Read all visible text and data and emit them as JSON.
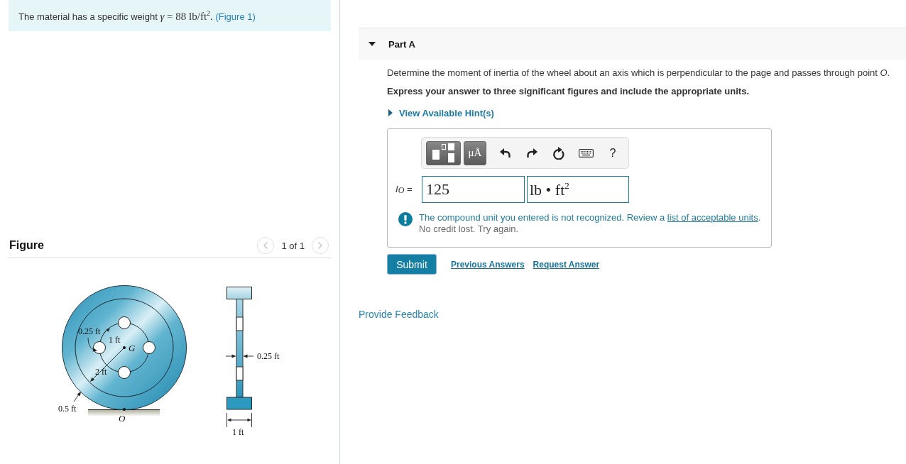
{
  "problem": {
    "text": "The material has a specific weight",
    "formula": "*γ* = 88 lb/ft$^{2}$.",
    "figure_link": "(Figure 1)"
  },
  "figure_panel": {
    "title": "Figure",
    "pager": {
      "previous": {
        "disabled": true
      },
      "counter": "1 of 1",
      "next": {
        "disabled": true
      }
    },
    "front_view": {
      "hole_radius": "0.25 ft",
      "hole_circle_radius": "1 ft",
      "center_point": "G",
      "inner_radius": "2 ft",
      "rim_thickness": "0.5 ft",
      "contact_point": "O"
    },
    "side_view": {
      "web_thickness": "0.25 ft",
      "width": "1 ft"
    }
  },
  "part": {
    "label": "Part A",
    "expanded": true,
    "question": "Determine the moment of inertia of the wheel about an axis which is perpendicular to the page and passes through point *O*.",
    "instruction": "Express your answer to three significant figures and include the appropriate units.",
    "hint": {
      "label": "View Available Hint(s)",
      "expanded": false
    },
    "answer": {
      "toolbar": [
        {
          "kind": "templates"
        },
        {
          "kind": "units",
          "label": "μÅ"
        },
        {
          "kind": "undo"
        },
        {
          "kind": "redo"
        },
        {
          "kind": "reset"
        },
        {
          "kind": "keyboard"
        },
        {
          "kind": "help",
          "label": "?"
        }
      ],
      "variable": "*I*$_{O}$ =",
      "value": "125",
      "units": "lb • ft$^{2}$",
      "feedback": {
        "message": "The compound unit you entered is not recognized. Review a",
        "link": "list of acceptable units",
        "after_link": ".",
        "note": "No credit lost. Try again."
      }
    },
    "actions": {
      "submit": "Submit",
      "links": [
        "Previous Answers",
        "Request Answer"
      ]
    }
  },
  "provide_feedback": "Provide Feedback"
}
